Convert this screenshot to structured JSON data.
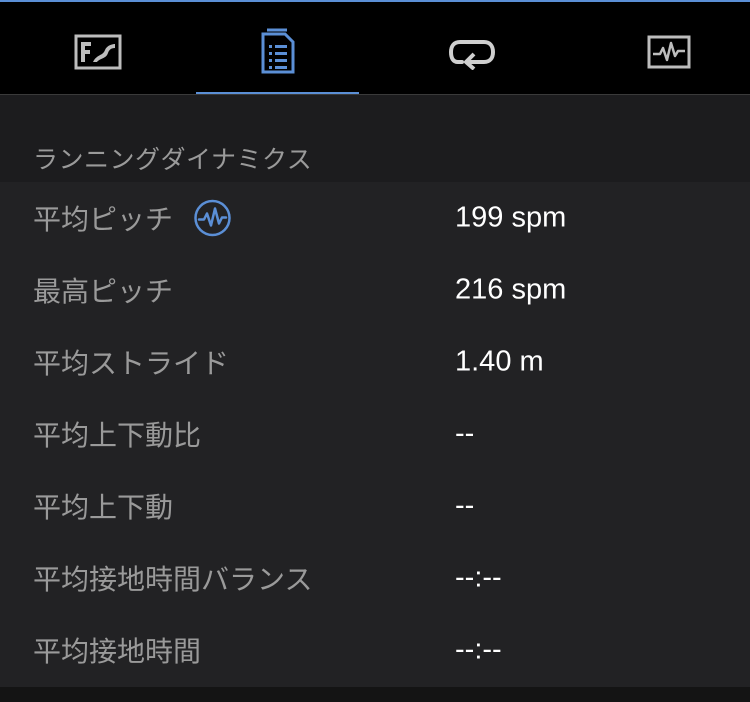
{
  "tabs": [
    {
      "icon": "map-summary-icon",
      "active": false
    },
    {
      "icon": "stats-list-icon",
      "active": true
    },
    {
      "icon": "laps-icon",
      "active": false
    },
    {
      "icon": "graph-icon",
      "active": false
    }
  ],
  "colors": {
    "accent": "#5b8fd6",
    "background": "#000000",
    "panel": "#222224",
    "label": "#9a9a9a",
    "value": "#ffffff"
  },
  "section": {
    "title": "ランニングダイナミクス"
  },
  "rows": [
    {
      "label": "平均ピッチ",
      "value": "199 spm",
      "has_info_icon": true
    },
    {
      "label": "最高ピッチ",
      "value": "216 spm"
    },
    {
      "label": "平均ストライド",
      "value": "1.40 m"
    },
    {
      "label": "平均上下動比",
      "value": "--"
    },
    {
      "label": "平均上下動",
      "value": "--"
    },
    {
      "label": "平均接地時間バランス",
      "value": "--:--"
    },
    {
      "label": "平均接地時間",
      "value": "--:--"
    }
  ]
}
